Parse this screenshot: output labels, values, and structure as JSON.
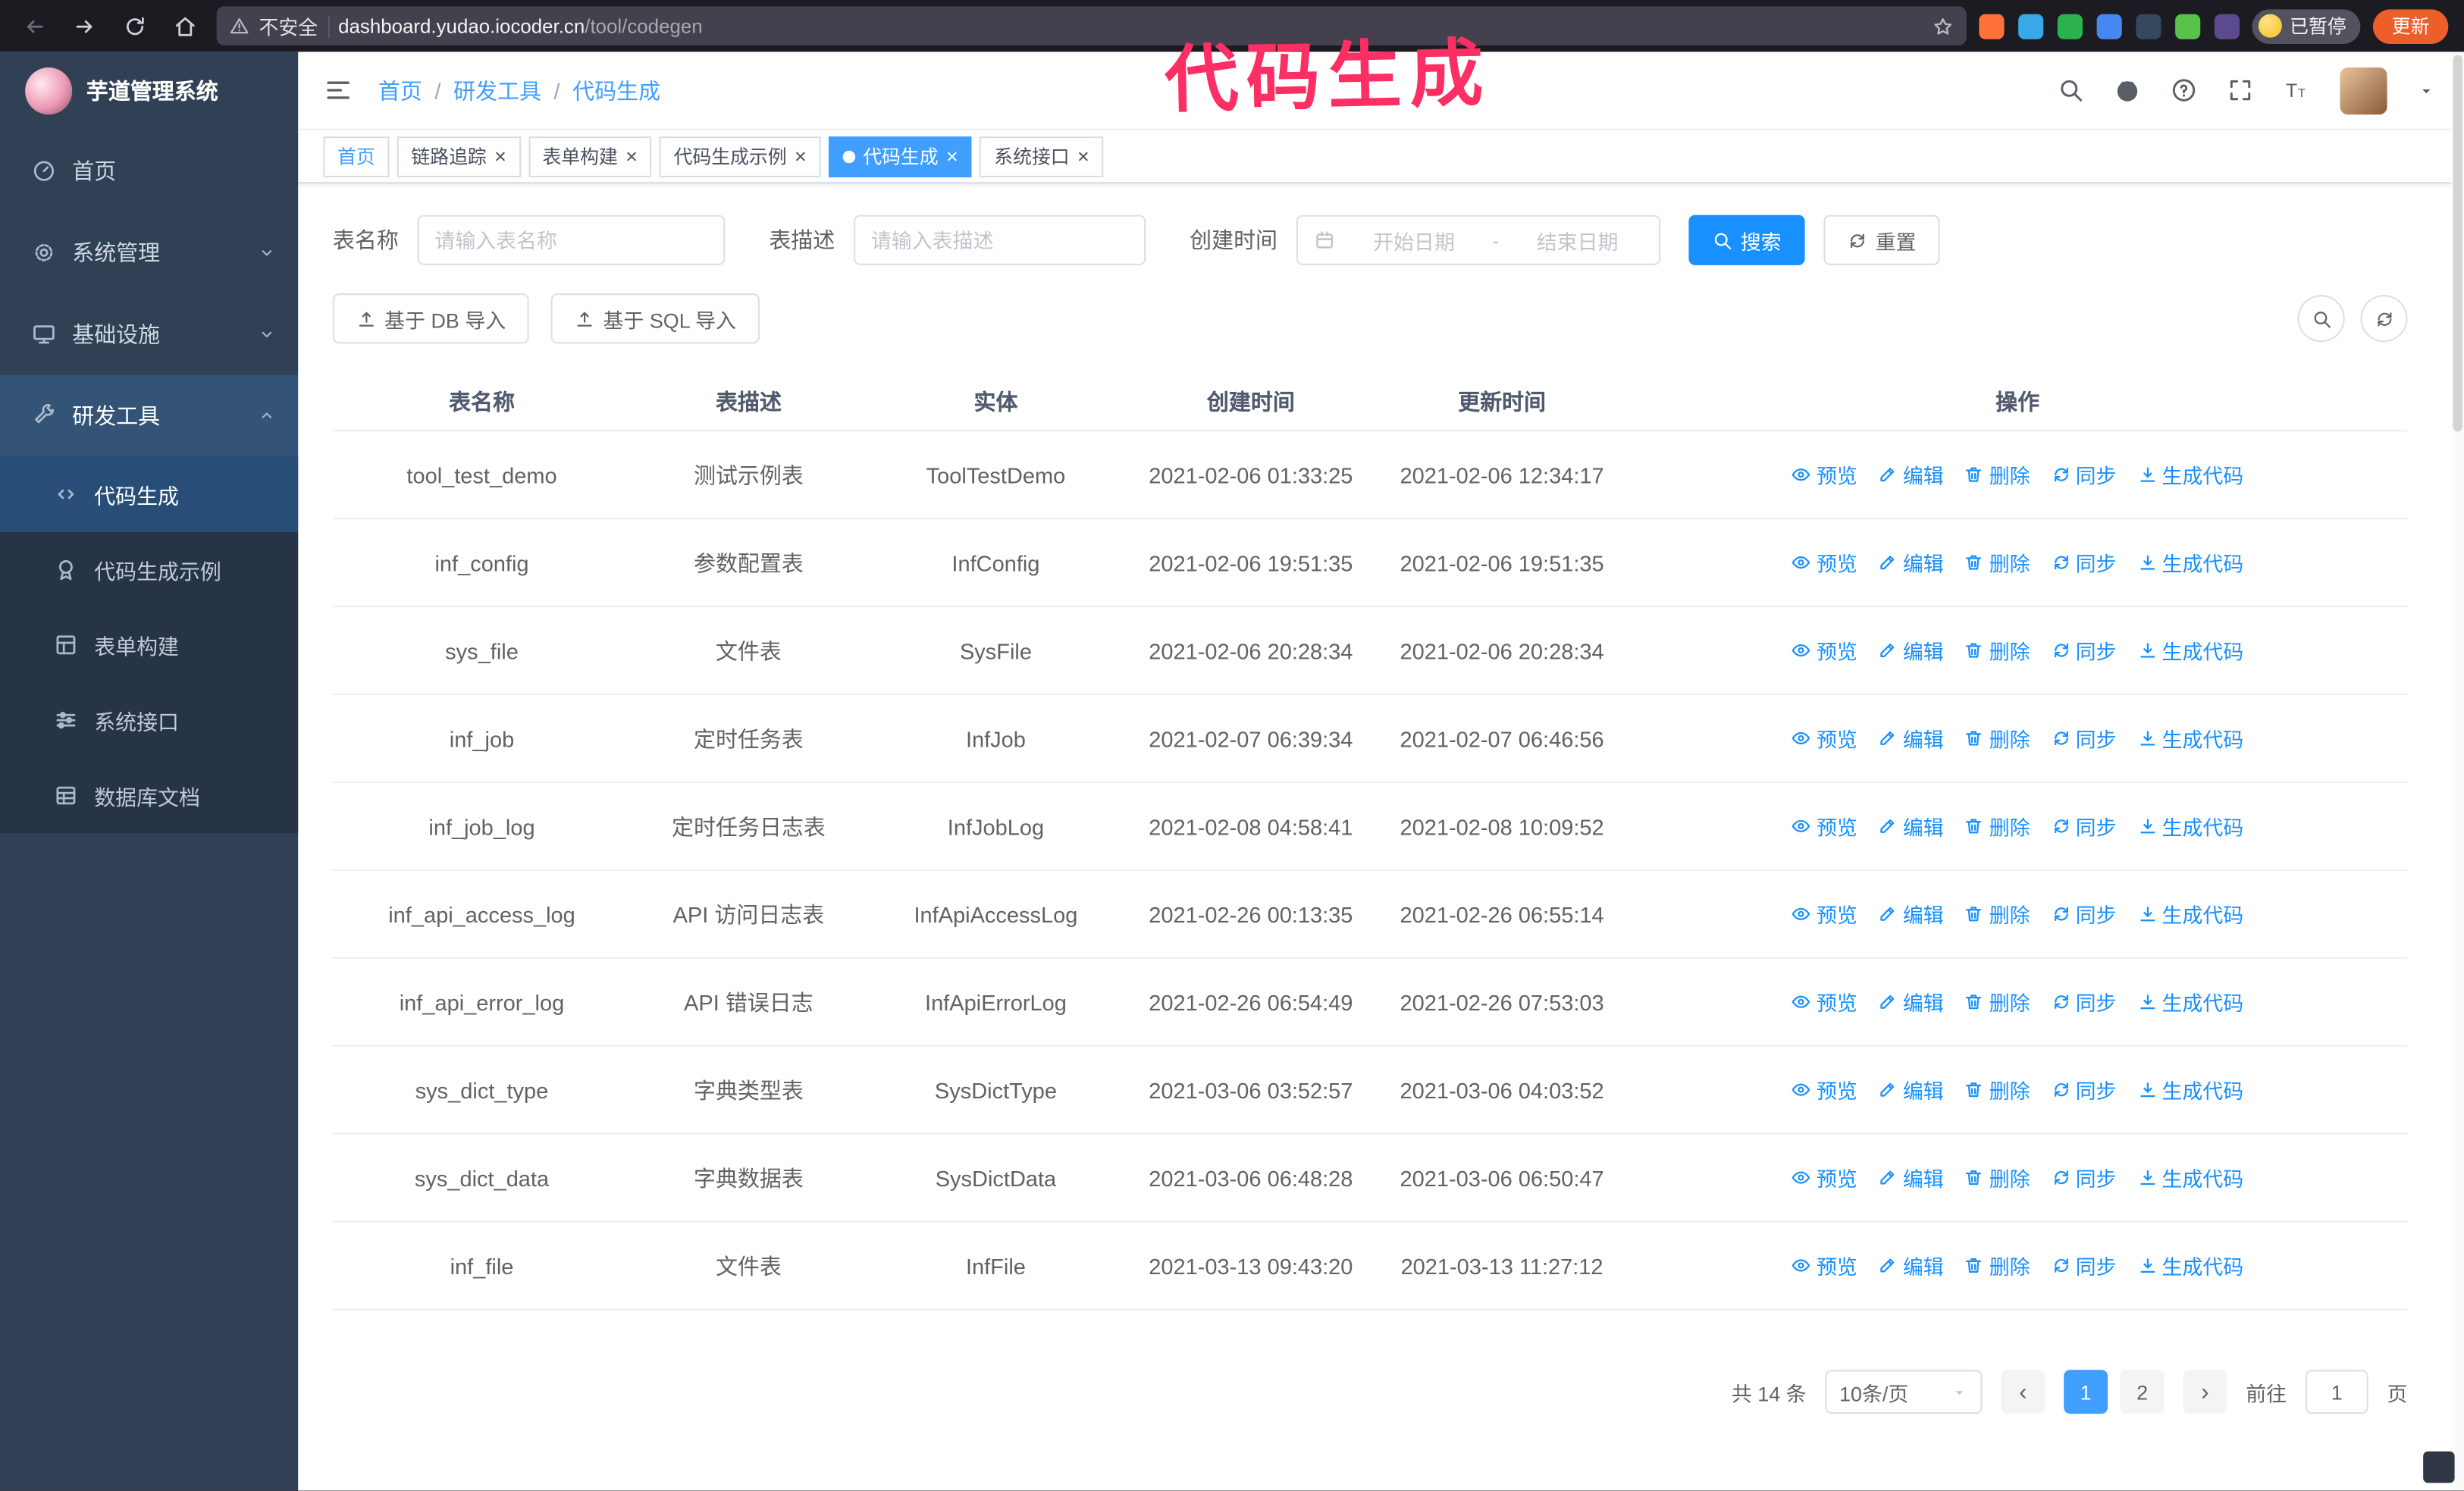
{
  "colors": {
    "primary": "#1890ff",
    "accent": "#409eff",
    "annotation": "#fb2f63",
    "sidebar-bg": "#304156",
    "submenu-bg": "#263445"
  },
  "browser": {
    "security_text": "不安全",
    "url_domain": "dashboard.yudao.iocoder.cn",
    "url_path": "/tool/codegen",
    "paused_badge": "已暂停",
    "update_button": "更新",
    "extensions": [
      {
        "color": "#ff7139"
      },
      {
        "color": "#38a8e8"
      },
      {
        "color": "#2bb24c"
      },
      {
        "color": "#4688f1"
      },
      {
        "color": "#34495e"
      },
      {
        "color": "#58c24a"
      },
      {
        "color": "#5b4a8f"
      }
    ]
  },
  "annotation_text": "代码生成",
  "sidebar": {
    "logo_title": "芋道管理系统",
    "menu": [
      {
        "key": "home",
        "label": "首页",
        "icon": "dashboard-icon"
      },
      {
        "key": "system",
        "label": "系统管理",
        "icon": "gear-icon",
        "chevron": "down"
      },
      {
        "key": "infra",
        "label": "基础设施",
        "icon": "monitor-icon",
        "chevron": "down"
      },
      {
        "key": "devtools",
        "label": "研发工具",
        "icon": "tools-icon",
        "chevron": "up",
        "active": true,
        "children": [
          {
            "key": "codegen",
            "label": "代码生成",
            "icon": "code-icon",
            "active": true
          },
          {
            "key": "codegen-example",
            "label": "代码生成示例",
            "icon": "medal-icon"
          },
          {
            "key": "form-builder",
            "label": "表单构建",
            "icon": "form-icon"
          },
          {
            "key": "api-doc",
            "label": "系统接口",
            "icon": "sliders-icon"
          },
          {
            "key": "db-doc",
            "label": "数据库文档",
            "icon": "table-doc-icon"
          }
        ]
      }
    ]
  },
  "navbar": {
    "breadcrumb": [
      {
        "label": "首页"
      },
      {
        "label": "研发工具"
      },
      {
        "label": "代码生成"
      }
    ]
  },
  "tags": [
    {
      "key": "home",
      "label": "首页",
      "closable": false,
      "affix": true
    },
    {
      "key": "tracer",
      "label": "链路追踪",
      "closable": true
    },
    {
      "key": "form-builder",
      "label": "表单构建",
      "closable": true
    },
    {
      "key": "codegen-example",
      "label": "代码生成示例",
      "closable": true
    },
    {
      "key": "codegen",
      "label": "代码生成",
      "closable": true,
      "active": true
    },
    {
      "key": "api-doc",
      "label": "系统接口",
      "closable": true
    }
  ],
  "filters": {
    "table_name_label": "表名称",
    "table_name_placeholder": "请输入表名称",
    "table_desc_label": "表描述",
    "table_desc_placeholder": "请输入表描述",
    "create_time_label": "创建时间",
    "date_start_placeholder": "开始日期",
    "date_separator": "-",
    "date_end_placeholder": "结束日期",
    "search_button": "搜索",
    "reset_button": "重置"
  },
  "toolbar": {
    "import_db_button": "基于 DB 导入",
    "import_sql_button": "基于 SQL 导入"
  },
  "table": {
    "columns": [
      "表名称",
      "表描述",
      "实体",
      "创建时间",
      "更新时间",
      "操作"
    ],
    "actions": [
      {
        "name": "preview-action",
        "label": "预览",
        "icon": "eye-icon"
      },
      {
        "name": "edit-action",
        "label": "编辑",
        "icon": "edit-icon"
      },
      {
        "name": "delete-action",
        "label": "删除",
        "icon": "trash-icon"
      },
      {
        "name": "sync-action",
        "label": "同步",
        "icon": "sync-icon"
      },
      {
        "name": "generate-code-action",
        "label": "生成代码",
        "icon": "download-icon"
      }
    ],
    "rows": [
      {
        "name": "tool_test_demo",
        "desc": "测试示例表",
        "entity": "ToolTestDemo",
        "created": "2021-02-06 01:33:25",
        "updated": "2021-02-06 12:34:17"
      },
      {
        "name": "inf_config",
        "desc": "参数配置表",
        "entity": "InfConfig",
        "created": "2021-02-06 19:51:35",
        "updated": "2021-02-06 19:51:35"
      },
      {
        "name": "sys_file",
        "desc": "文件表",
        "entity": "SysFile",
        "created": "2021-02-06 20:28:34",
        "updated": "2021-02-06 20:28:34"
      },
      {
        "name": "inf_job",
        "desc": "定时任务表",
        "entity": "InfJob",
        "created": "2021-02-07 06:39:34",
        "updated": "2021-02-07 06:46:56"
      },
      {
        "name": "inf_job_log",
        "desc": "定时任务日志表",
        "entity": "InfJobLog",
        "created": "2021-02-08 04:58:41",
        "updated": "2021-02-08 10:09:52"
      },
      {
        "name": "inf_api_access_log",
        "desc": "API 访问日志表",
        "entity": "InfApiAccessLog",
        "created": "2021-02-26 00:13:35",
        "updated": "2021-02-26 06:55:14"
      },
      {
        "name": "inf_api_error_log",
        "desc": "API 错误日志",
        "entity": "InfApiErrorLog",
        "created": "2021-02-26 06:54:49",
        "updated": "2021-02-26 07:53:03"
      },
      {
        "name": "sys_dict_type",
        "desc": "字典类型表",
        "entity": "SysDictType",
        "created": "2021-03-06 03:52:57",
        "updated": "2021-03-06 04:03:52"
      },
      {
        "name": "sys_dict_data",
        "desc": "字典数据表",
        "entity": "SysDictData",
        "created": "2021-03-06 06:48:28",
        "updated": "2021-03-06 06:50:47"
      },
      {
        "name": "inf_file",
        "desc": "文件表",
        "entity": "InfFile",
        "created": "2021-03-13 09:43:20",
        "updated": "2021-03-13 11:27:12"
      }
    ]
  },
  "pagination": {
    "total_text": "共 14 条",
    "page_size": "10条/页",
    "pages": [
      "1",
      "2"
    ],
    "active_page": "1",
    "goto_label": "前往",
    "goto_value": "1",
    "goto_suffix": "页"
  }
}
